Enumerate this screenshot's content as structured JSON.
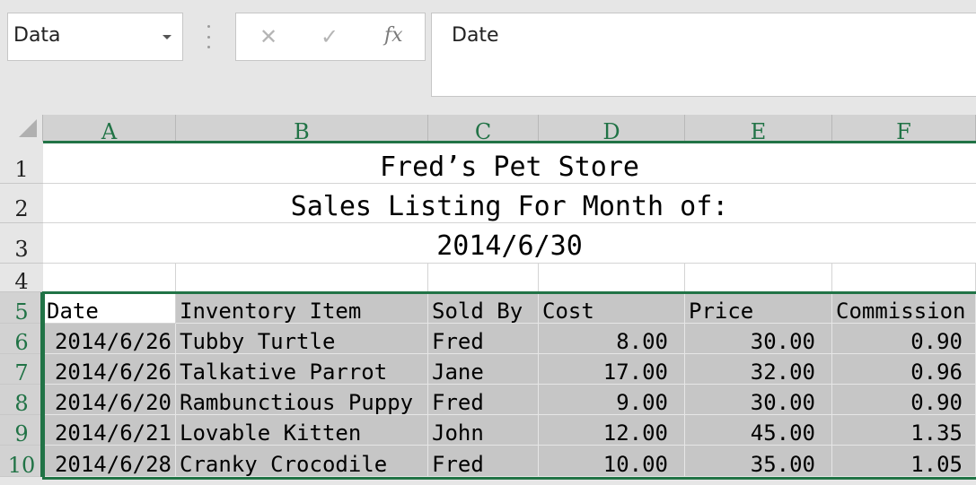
{
  "formula_bar": {
    "name_box": "Data",
    "cancel_glyph": "✕",
    "enter_glyph": "✓",
    "fx_label": "fx",
    "content": "Date"
  },
  "columns": [
    "A",
    "B",
    "C",
    "D",
    "E",
    "F"
  ],
  "row_numbers": [
    "1",
    "2",
    "3",
    "4",
    "5",
    "6",
    "7",
    "8",
    "9",
    "10"
  ],
  "title": {
    "line1": "Fred’s Pet Store",
    "line2": "Sales Listing For Month of:",
    "line3": "2014/6/30"
  },
  "table": {
    "headers": [
      "Date",
      "Inventory Item",
      "Sold By",
      "Cost",
      "Price",
      "Commission"
    ],
    "rows": [
      [
        "2014/6/26",
        "Tubby Turtle",
        "Fred",
        "8.00",
        "30.00",
        "0.90"
      ],
      [
        "2014/6/26",
        "Talkative Parrot",
        "Jane",
        "17.00",
        "32.00",
        "0.96"
      ],
      [
        "2014/6/20",
        "Rambunctious Puppy",
        "Fred",
        "9.00",
        "30.00",
        "0.90"
      ],
      [
        "2014/6/21",
        "Lovable Kitten",
        "John",
        "12.00",
        "45.00",
        "1.35"
      ],
      [
        "2014/6/28",
        "Cranky Crocodile",
        "Fred",
        "10.00",
        "35.00",
        "1.05"
      ]
    ]
  },
  "colors": {
    "accent": "#217346",
    "selection": "#c6c6c6"
  },
  "icons": [
    "dropdown-arrow-icon",
    "more-options-icon",
    "cancel-icon",
    "enter-icon",
    "insert-function-icon",
    "select-all-icon"
  ]
}
